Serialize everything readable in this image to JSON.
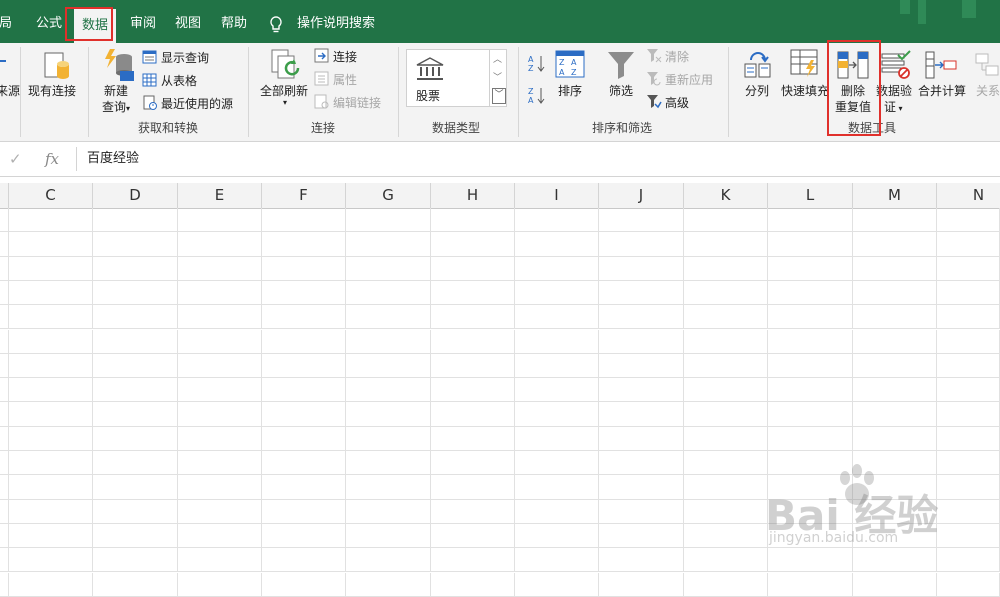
{
  "menubar": {
    "tabs": [
      "布局",
      "公式",
      "数据",
      "审阅",
      "视图",
      "帮助"
    ],
    "active_tab": "数据",
    "tell_me": "操作说明搜索"
  },
  "ribbon": {
    "get_transform": {
      "from_source_partial": "来源",
      "existing_connections": "现有连接",
      "new_query_line1": "新建",
      "new_query_line2": "查询",
      "show_queries": "显示查询",
      "from_table": "从表格",
      "recent_sources": "最近使用的源",
      "group_label": "获取和转换"
    },
    "connections": {
      "refresh_all": "全部刷新",
      "connections": "连接",
      "properties": "属性",
      "edit_links": "编辑链接",
      "group_label": "连接"
    },
    "data_types": {
      "stocks": "股票",
      "group_label": "数据类型"
    },
    "sort_filter": {
      "sort": "排序",
      "filter": "筛选",
      "clear": "清除",
      "reapply": "重新应用",
      "advanced": "高级",
      "group_label": "排序和筛选"
    },
    "data_tools": {
      "text_to_columns": "分列",
      "flash_fill": "快速填充",
      "remove_duplicates_line1": "删除",
      "remove_duplicates_line2": "重复值",
      "data_validation_line1": "数据验",
      "data_validation_line2": "证",
      "consolidate": "合并计算",
      "relationships": "关系",
      "group_label": "数据工具"
    }
  },
  "formula_bar": {
    "cancel_glyph": "✕",
    "enter_glyph": "✓",
    "fx_glyph": "fx",
    "value": "百度经验"
  },
  "grid": {
    "columns": [
      "C",
      "D",
      "E",
      "F",
      "G",
      "H",
      "I",
      "J",
      "K",
      "L",
      "M",
      "N"
    ]
  },
  "watermark": {
    "brand": "Bai 经验",
    "url": "jingyan.baidu.com"
  },
  "colors": {
    "excel_green": "#217346",
    "highlight_red": "#e0302b",
    "ribbon_bg": "#f3f3f3"
  }
}
